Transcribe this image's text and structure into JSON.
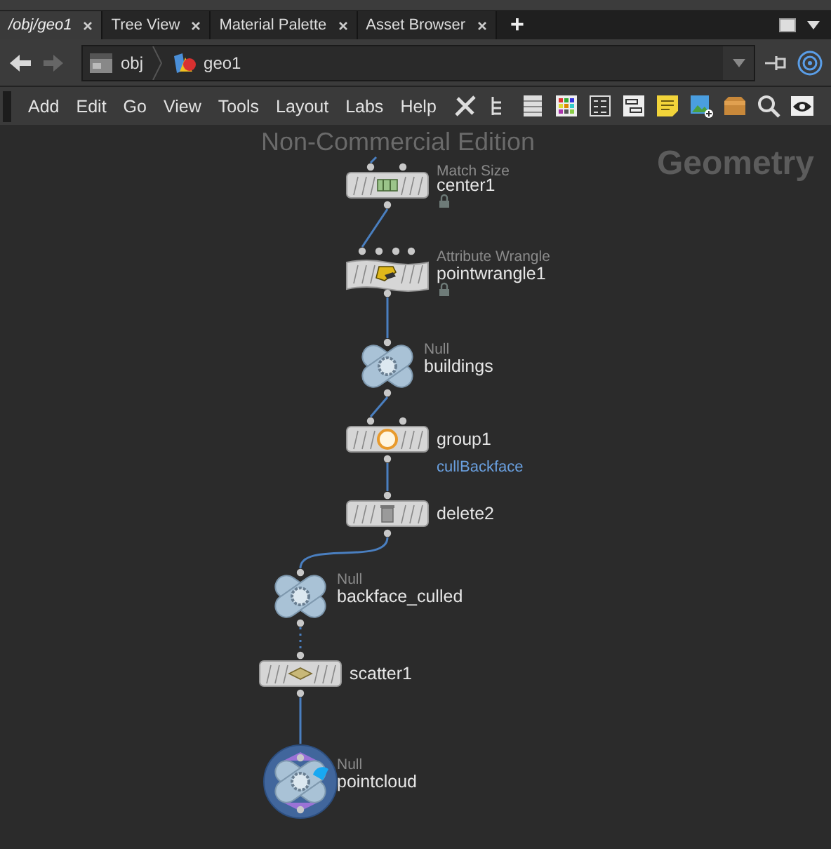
{
  "tabs": [
    {
      "label": "/obj/geo1",
      "selected": true
    },
    {
      "label": "Tree View",
      "selected": false
    },
    {
      "label": "Material Palette",
      "selected": false
    },
    {
      "label": "Asset Browser",
      "selected": false
    }
  ],
  "new_tab": "+",
  "path": [
    "obj",
    "geo1"
  ],
  "menu": [
    "Add",
    "Edit",
    "Go",
    "View",
    "Tools",
    "Layout",
    "Labs",
    "Help"
  ],
  "overlay": {
    "edition": "Non-Commercial Edition",
    "context": "Geometry"
  },
  "nodes": [
    {
      "kind": "box",
      "type_label": "Match Size",
      "name": "center1",
      "locked": true
    },
    {
      "kind": "box",
      "type_label": "Attribute Wrangle",
      "name": "pointwrangle1",
      "locked": true
    },
    {
      "kind": "null",
      "type_label": "Null",
      "name": "buildings",
      "display": false
    },
    {
      "kind": "box",
      "name": "group1",
      "comment": "cullBackface",
      "locked": false
    },
    {
      "kind": "box",
      "name": "delete2",
      "locked": false
    },
    {
      "kind": "null",
      "type_label": "Null",
      "name": "backface_culled",
      "display": false
    },
    {
      "kind": "box",
      "name": "scatter1",
      "locked": false
    },
    {
      "kind": "null",
      "type_label": "Null",
      "name": "pointcloud",
      "display": true
    }
  ]
}
